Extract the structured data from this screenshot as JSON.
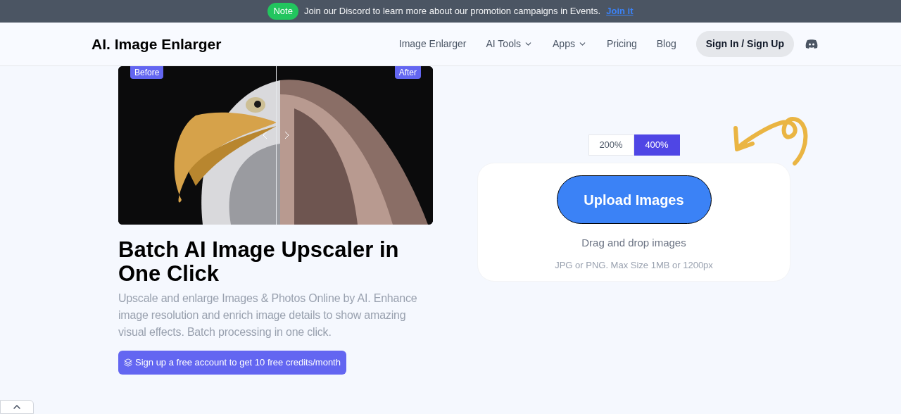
{
  "banner": {
    "badge": "Note",
    "text": "Join our Discord to learn more about our promotion campaigns in Events.",
    "link": "Join it"
  },
  "nav": {
    "logo": "AI. Image Enlarger",
    "items": [
      {
        "label": "Image Enlarger",
        "dropdown": false
      },
      {
        "label": "AI Tools",
        "dropdown": true
      },
      {
        "label": "Apps",
        "dropdown": true
      },
      {
        "label": "Pricing",
        "dropdown": false
      },
      {
        "label": "Blog",
        "dropdown": false
      }
    ],
    "sign_in": "Sign In / Sign Up"
  },
  "comparison": {
    "before": "Before",
    "after": "After",
    "level": 0.5
  },
  "hero": {
    "title": "Batch AI Image Upscaler in One Click",
    "description": "Upscale and enlarge Images & Photos Online by AI. Enhance image resolution and enrich image details to show amazing visual effects. Batch processing in one click.",
    "cta": "Sign up a free account to get 10 free credits/month"
  },
  "scale_options": [
    {
      "label": "200%",
      "selected": false
    },
    {
      "label": "400%",
      "selected": true
    }
  ],
  "upload": {
    "button": "Upload Images",
    "hint": "Drag and drop images",
    "limits": "JPG or PNG. Max Size 1MB or 1200px"
  }
}
